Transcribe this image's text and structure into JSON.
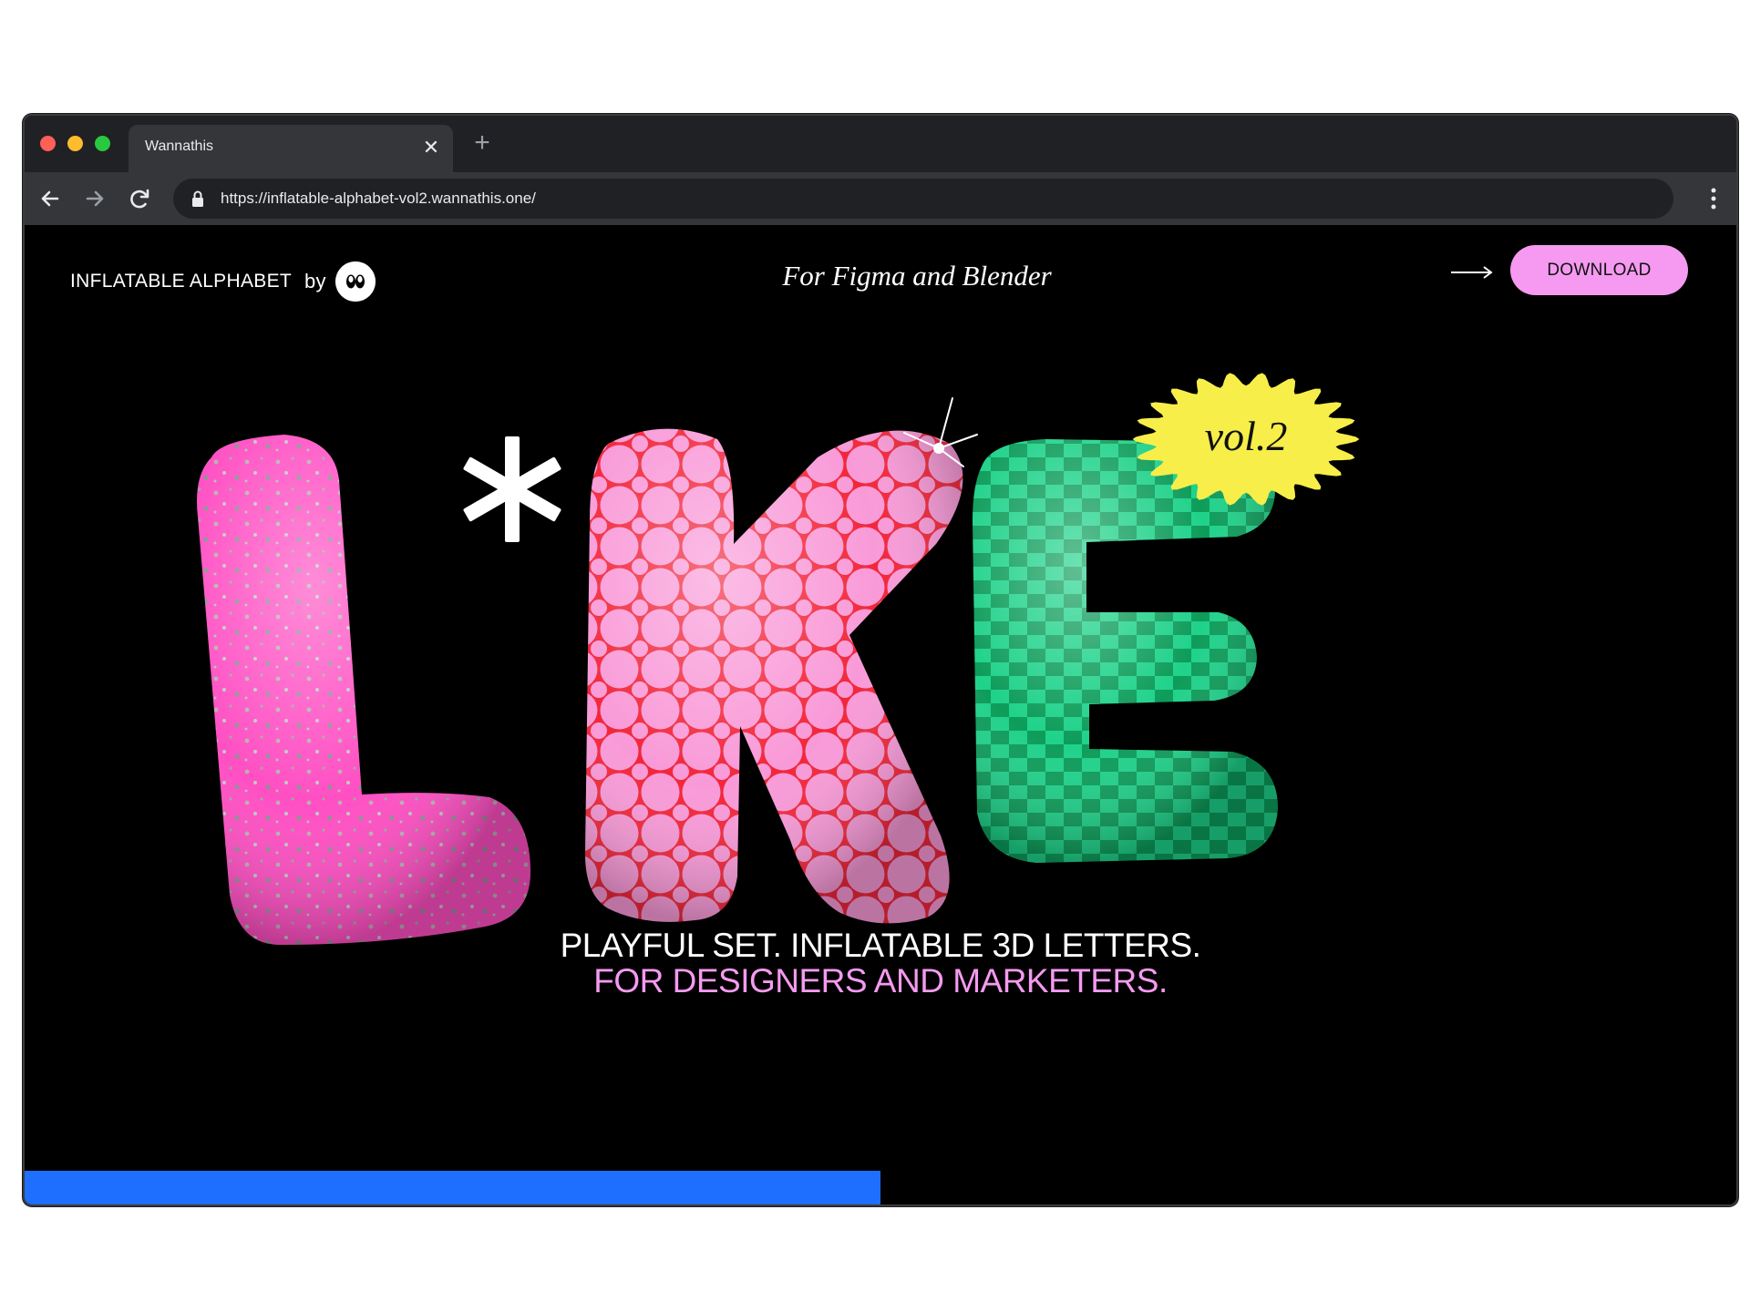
{
  "browser": {
    "tab_title": "Wannathis",
    "url": "https://inflatable-alphabet-vol2.wannathis.one/",
    "icons": [
      "close-icon",
      "plus-icon",
      "back-arrow-icon",
      "forward-arrow-icon",
      "reload-icon",
      "lock-icon",
      "more-vertical-icon"
    ]
  },
  "header": {
    "brand": "INFLATABLE ALPHABET",
    "by": "by",
    "tagline": "For Figma and Blender",
    "download_label": "DOWNLOAD"
  },
  "hero": {
    "letters": [
      "L",
      "*",
      "K",
      "E"
    ],
    "badge": "vol.2",
    "headline_line1": "PLAYFUL SET. INFLATABLE 3D LETTERS.",
    "headline_line2": "FOR DESIGNERS AND MARKETERS."
  },
  "progress": {
    "value": 0.5
  },
  "colors": {
    "pink": "#f59af0",
    "hot_pink": "#ff4fc3",
    "red": "#f2263a",
    "green": "#1fd28a",
    "dark_green": "#0d9c5a",
    "yellow": "#f7ee4a",
    "progress_blue": "#1e6fff"
  }
}
